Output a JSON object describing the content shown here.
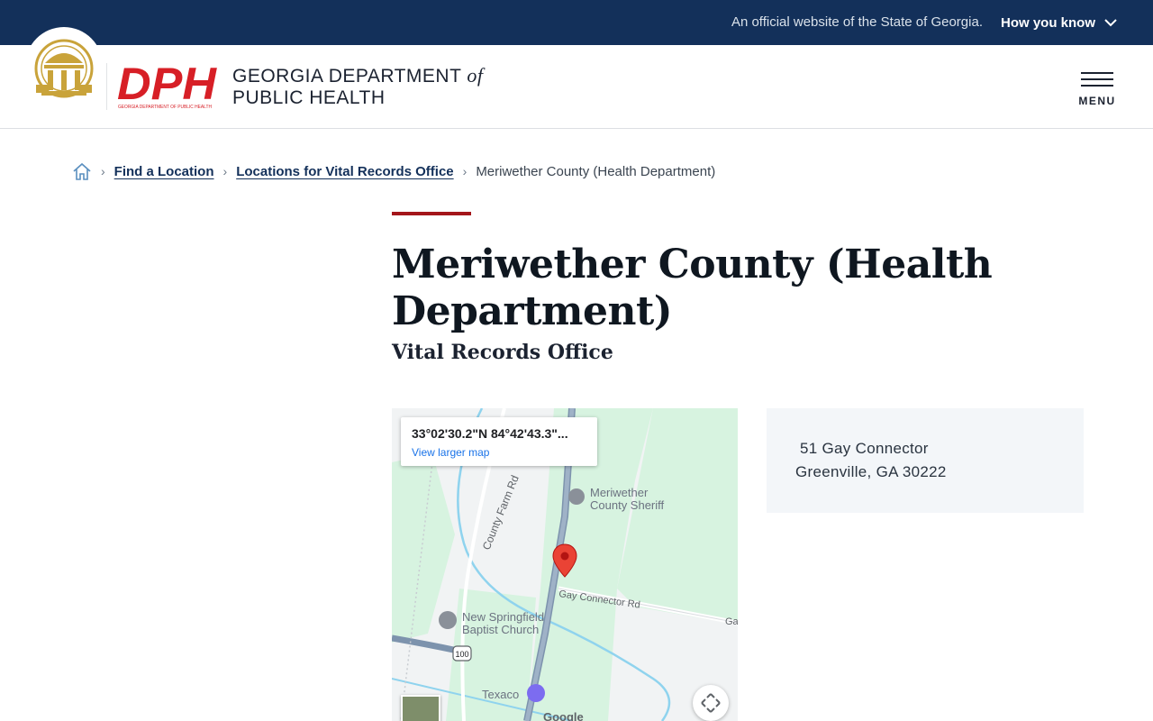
{
  "topbar": {
    "official_text": "An official website of the State of Georgia.",
    "how_you_know": "How you know"
  },
  "header": {
    "dept_line1": "GEORGIA DEPARTMENT",
    "dept_of": "of",
    "dept_line2": "PUBLIC HEALTH",
    "logo_text": "DPH",
    "logo_subtext": "GEORGIA DEPARTMENT OF PUBLIC HEALTH",
    "menu_label": "MENU"
  },
  "breadcrumb": {
    "items": [
      {
        "label": "Find a Location"
      },
      {
        "label": "Locations for Vital Records Office"
      }
    ],
    "current": "Meriwether County (Health Department)"
  },
  "page": {
    "title": "Meriwether County (Health Department)",
    "subtitle": "Vital Records Office"
  },
  "map": {
    "coords": "33°02'30.2\"N 84°42'43.3\"...",
    "view_larger": "View larger map",
    "labels": {
      "county_farm_rd": "County Farm Rd",
      "sheriff_1": "Meriwether",
      "sheriff_2": "County Sheriff",
      "gay_connector": "Gay Connector Rd",
      "gay_edge": "Ga",
      "church_1": "New Springfield",
      "church_2": "Baptist Church",
      "route": "100",
      "texaco": "Texaco",
      "google": "Google"
    }
  },
  "address": {
    "line1": "51 Gay Connector",
    "line2": "Greenville, GA 30222"
  },
  "colors": {
    "navy": "#13305a",
    "accent_red": "#a4161a",
    "logo_red": "#d71f26",
    "seal_gold": "#c9a33a"
  }
}
